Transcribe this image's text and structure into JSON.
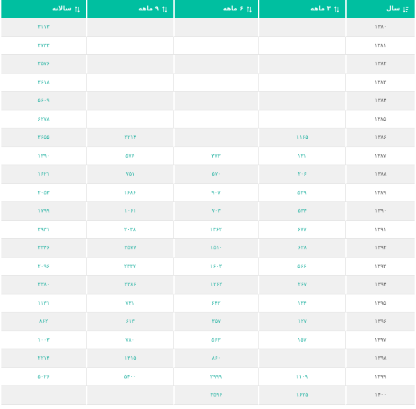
{
  "table": {
    "headers": {
      "year": "سال",
      "q3": "۳ ماهه",
      "q6": "۶ ماهه",
      "q9": "۹ ماهه",
      "annual": "سالانه"
    },
    "icons": {
      "year_sort": "sort-numeric-desc-icon",
      "column_sort": "sort-arrows-icon"
    },
    "colors": {
      "header_bg": "#00bfa0",
      "value_text": "#26b3a3",
      "zebra": "#f0f0f0"
    },
    "rows": [
      {
        "year": "۱۳۸۰",
        "q3": "",
        "q6": "",
        "q9": "",
        "annual": "۳۱۱۳"
      },
      {
        "year": "۱۳۸۱",
        "q3": "",
        "q6": "",
        "q9": "",
        "annual": "۳۷۳۳"
      },
      {
        "year": "۱۳۸۲",
        "q3": "",
        "q6": "",
        "q9": "",
        "annual": "۳۵۷۶"
      },
      {
        "year": "۱۳۸۳",
        "q3": "",
        "q6": "",
        "q9": "",
        "annual": "۳۶۱۸"
      },
      {
        "year": "۱۳۸۴",
        "q3": "",
        "q6": "",
        "q9": "",
        "annual": "۵۶۰۹"
      },
      {
        "year": "۱۳۸۵",
        "q3": "",
        "q6": "",
        "q9": "",
        "annual": "۶۲۷۸"
      },
      {
        "year": "۱۳۸۶",
        "q3": "۱۱۶۵",
        "q6": "",
        "q9": "۲۲۱۴",
        "annual": "۳۶۵۵"
      },
      {
        "year": "۱۳۸۷",
        "q3": "۱۳۱",
        "q6": "۳۷۳",
        "q9": "۵۷۶",
        "annual": "۱۳۹۰"
      },
      {
        "year": "۱۳۸۸",
        "q3": "۲۰۶",
        "q6": "۵۷۰",
        "q9": "۷۵۱",
        "annual": "۱۶۲۱"
      },
      {
        "year": "۱۳۸۹",
        "q3": "۵۲۹",
        "q6": "۹۰۷",
        "q9": "۱۶۸۶",
        "annual": "۲۰۵۳"
      },
      {
        "year": "۱۳۹۰",
        "q3": "۵۳۴",
        "q6": "۷۰۳",
        "q9": "۱۰۶۱",
        "annual": "۱۷۹۹"
      },
      {
        "year": "۱۳۹۱",
        "q3": "۶۷۷",
        "q6": "۱۳۶۲",
        "q9": "۲۰۳۸",
        "annual": "۳۹۳۱"
      },
      {
        "year": "۱۳۹۲",
        "q3": "۶۲۸",
        "q6": "۱۵۱۰",
        "q9": "۲۵۷۷",
        "annual": "۳۳۴۶"
      },
      {
        "year": "۱۳۹۳",
        "q3": "۵۶۶",
        "q6": "۱۶۰۳",
        "q9": "۲۳۳۷",
        "annual": "۲۰۹۶"
      },
      {
        "year": "۱۳۹۴",
        "q3": "۲۶۷",
        "q6": "۱۲۶۲",
        "q9": "۲۳۸۶",
        "annual": "۳۳۸۰"
      },
      {
        "year": "۱۳۹۵",
        "q3": "۱۳۴",
        "q6": "۶۴۲",
        "q9": "۷۳۱",
        "annual": "۱۱۳۱"
      },
      {
        "year": "۱۳۹۶",
        "q3": "۱۲۷",
        "q6": "۳۵۷",
        "q9": "۶۱۳",
        "annual": "۸۶۲"
      },
      {
        "year": "۱۳۹۷",
        "q3": "۱۵۷",
        "q6": "۵۶۳",
        "q9": "۷۸۰",
        "annual": "۱۰۰۳"
      },
      {
        "year": "۱۳۹۸",
        "q3": "",
        "q6": "۸۶۰",
        "q9": "۱۴۱۵",
        "annual": "۲۲۱۴"
      },
      {
        "year": "۱۳۹۹",
        "q3": "۱۱۰۹",
        "q6": "۲۹۹۹",
        "q9": "۵۴۰۰",
        "annual": "۵۰۲۶"
      },
      {
        "year": "۱۴۰۰",
        "q3": "۱۶۲۵",
        "q6": "۳۵۹۶",
        "q9": "",
        "annual": ""
      }
    ]
  }
}
